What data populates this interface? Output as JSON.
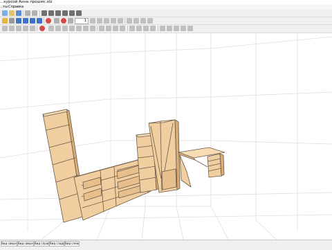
{
  "window": {
    "title": "...курсой Анна прошмс.stz"
  },
  "menu": {
    "items": [
      {
        "label": "..ты"
      },
      {
        "label": "Справка"
      }
    ]
  },
  "toolbar": {
    "dimension_value": "1"
  },
  "status_tabs": [
    {
      "label": "Вид сверху"
    },
    {
      "label": "Вид сверху"
    },
    {
      "label": "Вид справа"
    },
    {
      "label": "Вид сзади"
    },
    {
      "label": "Вид слева"
    }
  ],
  "colors": {
    "wood": "#f0ceA0",
    "wood_dark": "#d9ac76",
    "grid": "#dedede",
    "outline": "#6a5a48"
  }
}
